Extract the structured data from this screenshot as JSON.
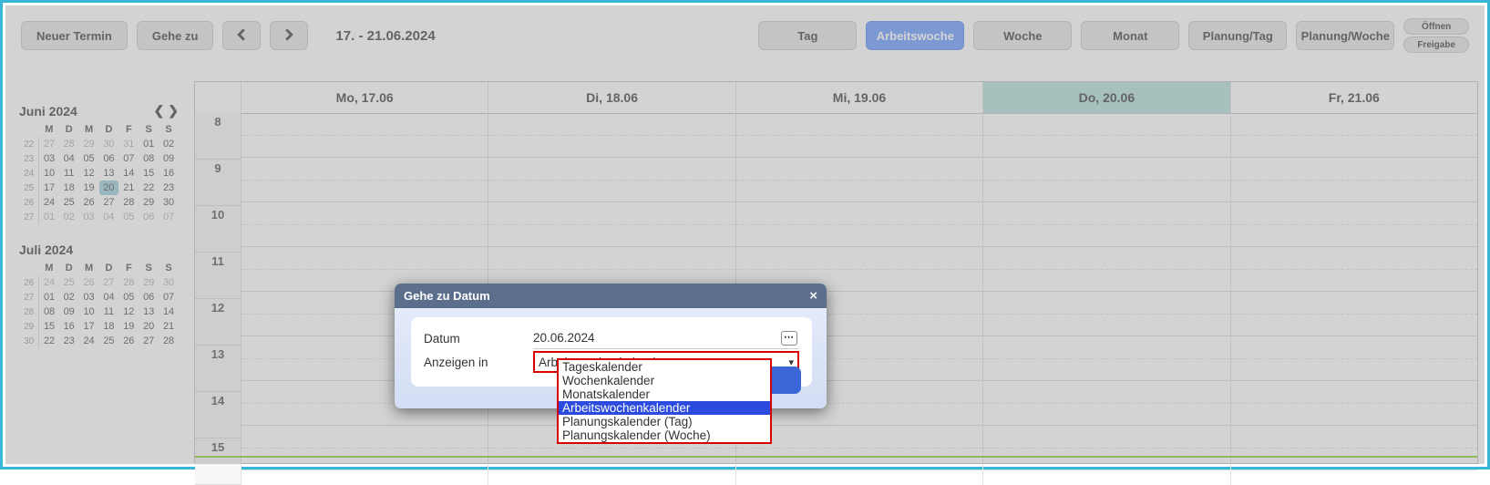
{
  "toolbar": {
    "new_appointment": "Neuer Termin",
    "goto": "Gehe zu",
    "date_range": "17. - 21.06.2024",
    "views": {
      "day": "Tag",
      "workweek": "Arbeitswoche",
      "week": "Woche",
      "month": "Monat",
      "plan_day": "Planung/Tag",
      "plan_week": "Planung/Woche"
    },
    "open": "Öffnen",
    "release": "Freigabe"
  },
  "mini_calendars": [
    {
      "title": "Juni 2024",
      "show_nav": true,
      "dow": [
        "M",
        "D",
        "M",
        "D",
        "F",
        "S",
        "S"
      ],
      "weeks": [
        {
          "wk": "22",
          "days": [
            {
              "n": "27",
              "o": true
            },
            {
              "n": "28",
              "o": true
            },
            {
              "n": "29",
              "o": true
            },
            {
              "n": "30",
              "o": true
            },
            {
              "n": "31",
              "o": true
            },
            {
              "n": "01"
            },
            {
              "n": "02"
            }
          ]
        },
        {
          "wk": "23",
          "days": [
            {
              "n": "03"
            },
            {
              "n": "04"
            },
            {
              "n": "05"
            },
            {
              "n": "06"
            },
            {
              "n": "07"
            },
            {
              "n": "08"
            },
            {
              "n": "09"
            }
          ]
        },
        {
          "wk": "24",
          "days": [
            {
              "n": "10"
            },
            {
              "n": "11"
            },
            {
              "n": "12"
            },
            {
              "n": "13"
            },
            {
              "n": "14"
            },
            {
              "n": "15"
            },
            {
              "n": "16"
            }
          ]
        },
        {
          "wk": "25",
          "days": [
            {
              "n": "17"
            },
            {
              "n": "18"
            },
            {
              "n": "19"
            },
            {
              "n": "20",
              "today": true
            },
            {
              "n": "21"
            },
            {
              "n": "22"
            },
            {
              "n": "23"
            }
          ]
        },
        {
          "wk": "26",
          "days": [
            {
              "n": "24"
            },
            {
              "n": "25"
            },
            {
              "n": "26"
            },
            {
              "n": "27"
            },
            {
              "n": "28"
            },
            {
              "n": "29"
            },
            {
              "n": "30"
            }
          ]
        },
        {
          "wk": "27",
          "days": [
            {
              "n": "01",
              "o": true
            },
            {
              "n": "02",
              "o": true
            },
            {
              "n": "03",
              "o": true
            },
            {
              "n": "04",
              "o": true
            },
            {
              "n": "05",
              "o": true
            },
            {
              "n": "06",
              "o": true
            },
            {
              "n": "07",
              "o": true
            }
          ]
        }
      ]
    },
    {
      "title": "Juli 2024",
      "show_nav": false,
      "dow": [
        "M",
        "D",
        "M",
        "D",
        "F",
        "S",
        "S"
      ],
      "weeks": [
        {
          "wk": "26",
          "days": [
            {
              "n": "24",
              "o": true
            },
            {
              "n": "25",
              "o": true
            },
            {
              "n": "26",
              "o": true
            },
            {
              "n": "27",
              "o": true
            },
            {
              "n": "28",
              "o": true
            },
            {
              "n": "29",
              "o": true
            },
            {
              "n": "30",
              "o": true
            }
          ]
        },
        {
          "wk": "27",
          "days": [
            {
              "n": "01"
            },
            {
              "n": "02"
            },
            {
              "n": "03"
            },
            {
              "n": "04"
            },
            {
              "n": "05"
            },
            {
              "n": "06"
            },
            {
              "n": "07"
            }
          ]
        },
        {
          "wk": "28",
          "days": [
            {
              "n": "08"
            },
            {
              "n": "09"
            },
            {
              "n": "10"
            },
            {
              "n": "11"
            },
            {
              "n": "12"
            },
            {
              "n": "13"
            },
            {
              "n": "14"
            }
          ]
        },
        {
          "wk": "29",
          "days": [
            {
              "n": "15"
            },
            {
              "n": "16"
            },
            {
              "n": "17"
            },
            {
              "n": "18"
            },
            {
              "n": "19"
            },
            {
              "n": "20"
            },
            {
              "n": "21"
            }
          ]
        },
        {
          "wk": "30",
          "days": [
            {
              "n": "22"
            },
            {
              "n": "23"
            },
            {
              "n": "24"
            },
            {
              "n": "25"
            },
            {
              "n": "26"
            },
            {
              "n": "27"
            },
            {
              "n": "28"
            }
          ]
        }
      ]
    }
  ],
  "main": {
    "day_headers": [
      "Mo, 17.06",
      "Di, 18.06",
      "Mi, 19.06",
      "Do, 20.06",
      "Fr, 21.06"
    ],
    "today_index": 3,
    "hours": [
      "8",
      "9",
      "10",
      "11",
      "12",
      "13",
      "14",
      "15"
    ]
  },
  "dialog": {
    "title": "Gehe zu Datum",
    "date_label": "Datum",
    "date_value": "20.06.2024",
    "show_in_label": "Anzeigen in",
    "show_in_value": "Arbeitswochenkalender",
    "options": [
      {
        "label": "Tageskalender"
      },
      {
        "label": "Wochenkalender"
      },
      {
        "label": "Monatskalender"
      },
      {
        "label": "Arbeitswochenkalender",
        "selected": true
      },
      {
        "label": "Planungskalender (Tag)"
      },
      {
        "label": "Planungskalender (Woche)"
      }
    ]
  }
}
